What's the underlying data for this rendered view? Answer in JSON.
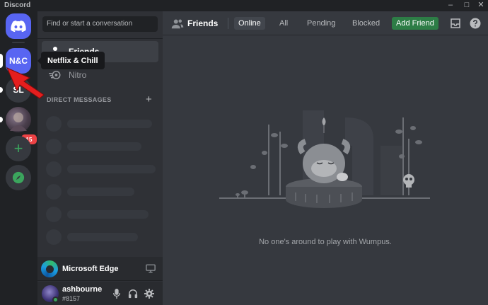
{
  "window": {
    "title": "Discord",
    "controls": [
      "minimize-icon",
      "maximize-icon",
      "close-icon"
    ]
  },
  "servers": {
    "home_icon": "discord-logo-icon",
    "items": [
      {
        "label": "N&C",
        "name": "Netflix & Chill"
      },
      {
        "label": "SL"
      },
      {
        "label": "",
        "badge": "15"
      }
    ],
    "add_label": "+",
    "explore_icon": "compass-icon"
  },
  "tooltip": {
    "text": "Netflix & Chill"
  },
  "sidebar": {
    "search": {
      "placeholder": "Find or start a conversation"
    },
    "nav": [
      {
        "label": "Friends",
        "icon": "friends-icon"
      },
      {
        "label": "Nitro",
        "icon": "nitro-icon"
      }
    ],
    "dm_header": "DIRECT MESSAGES",
    "dm_add": "+"
  },
  "activity": {
    "app": "Microsoft Edge",
    "icon": "edge-icon",
    "action_icon": "screen-share-icon"
  },
  "user": {
    "name": "ashbourne",
    "tag": "#8157",
    "status_color": "#3ba55d",
    "icons": [
      "microphone-icon",
      "headphones-icon",
      "settings-icon"
    ]
  },
  "header": {
    "title": "Friends",
    "tabs": [
      "Online",
      "All",
      "Pending",
      "Blocked"
    ],
    "active_tab": "Online",
    "add_friend": "Add Friend",
    "right_icons": [
      "inbox-icon",
      "help-icon"
    ]
  },
  "main": {
    "empty_message": "No one's around to play with Wumpus.",
    "illustration": "wumpus-sleeping-illustration"
  },
  "colors": {
    "blurple": "#5865f2",
    "green": "#3ba55d",
    "add_friend_green": "#2d7d46",
    "badge_red": "#ed4245",
    "pointer_red": "#e41e1e"
  }
}
